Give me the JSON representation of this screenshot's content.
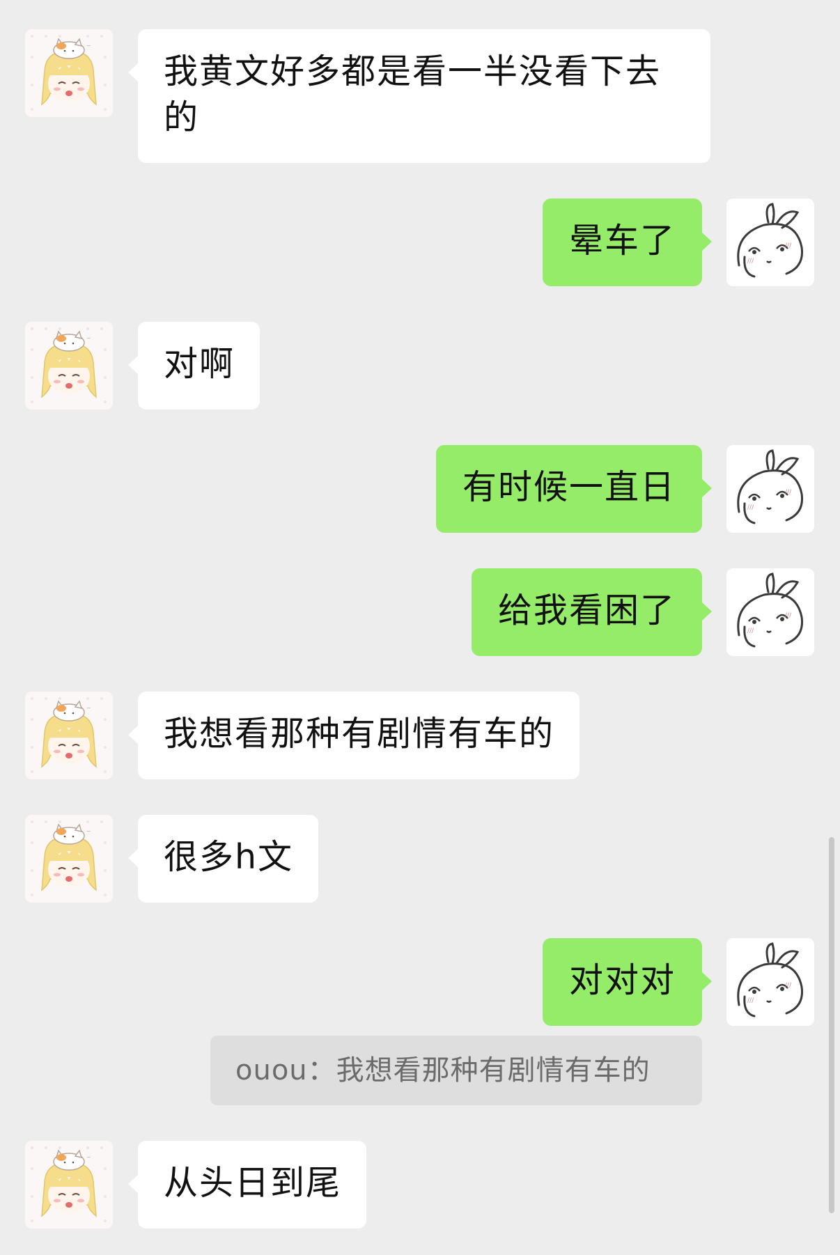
{
  "chat": {
    "messages": [
      {
        "side": "in",
        "text": "我黄文好多都是看一半没看下去的"
      },
      {
        "side": "out",
        "text": "晕车了"
      },
      {
        "side": "in",
        "text": "对啊"
      },
      {
        "side": "out",
        "text": "有时候一直日"
      },
      {
        "side": "out",
        "text": "给我看困了"
      },
      {
        "side": "in",
        "text": "我想看那种有剧情有车的"
      },
      {
        "side": "in",
        "text": "很多h文"
      },
      {
        "side": "out",
        "text": "对对对"
      },
      {
        "side": "in",
        "text": "从头日到尾"
      }
    ],
    "quote": {
      "text": "ouou：我想看那种有剧情有车的"
    }
  },
  "icons": {
    "incoming_avatar": "anime-girl-with-cat-avatar",
    "outgoing_avatar": "bunny-avatar"
  },
  "colors": {
    "background": "#ededed",
    "incoming_bubble": "#ffffff",
    "outgoing_bubble": "#95ec69",
    "quote_bg": "#dedede",
    "quote_text": "#6b6b6b"
  }
}
